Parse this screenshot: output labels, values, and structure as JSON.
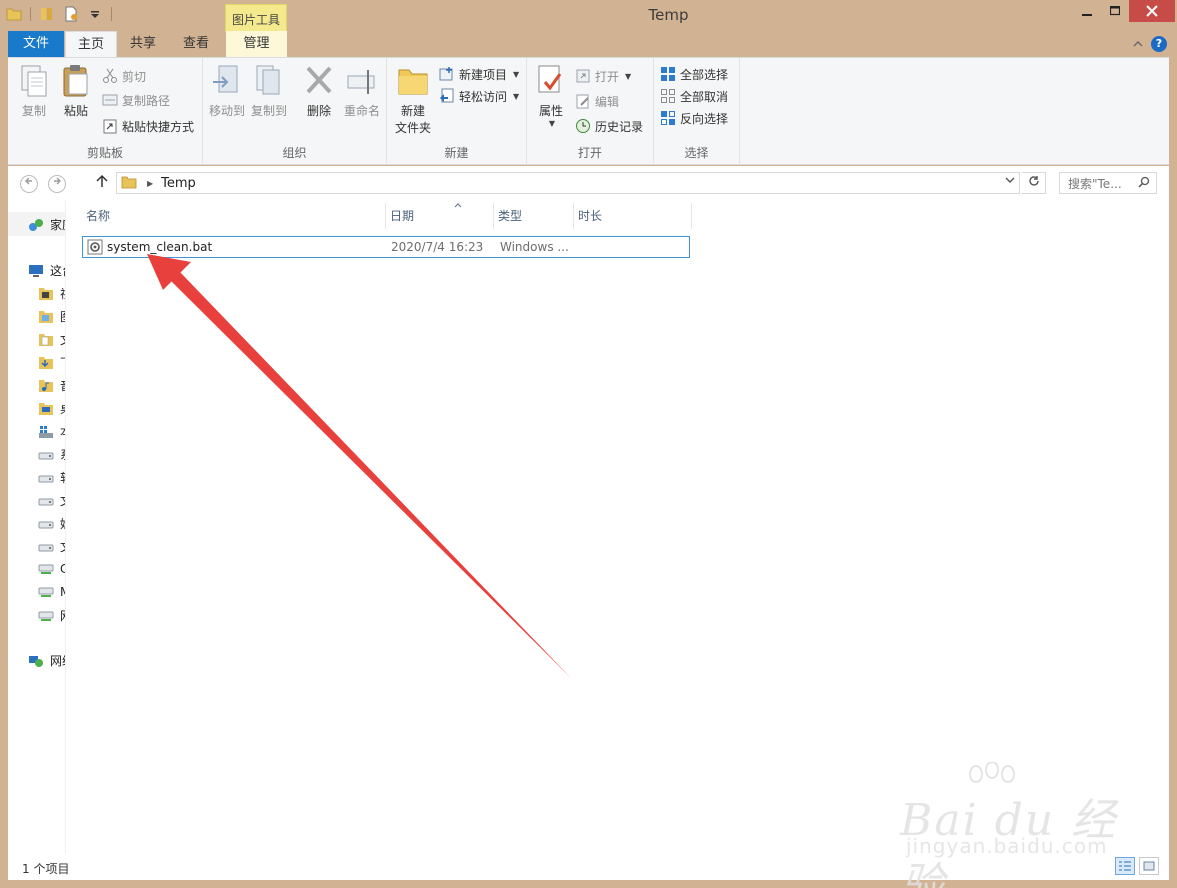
{
  "window": {
    "title": "Temp",
    "context_tab_header": "图片工具"
  },
  "tabs": {
    "file": "文件",
    "home": "主页",
    "share": "共享",
    "view": "查看",
    "manage": "管理"
  },
  "ribbon": {
    "clipboard": {
      "label": "剪贴板",
      "copy": "复制",
      "paste": "粘贴",
      "cut": "剪切",
      "copy_path": "复制路径",
      "paste_shortcut": "粘贴快捷方式"
    },
    "organize": {
      "label": "组织",
      "move_to": "移动到",
      "copy_to": "复制到",
      "delete": "删除",
      "rename": "重命名"
    },
    "new": {
      "label": "新建",
      "new_folder_line1": "新建",
      "new_folder_line2": "文件夹",
      "new_item": "新建项目",
      "easy_access": "轻松访问"
    },
    "open": {
      "label": "打开",
      "properties": "属性",
      "open": "打开",
      "edit": "编辑",
      "history": "历史记录"
    },
    "select": {
      "label": "选择",
      "select_all": "全部选择",
      "select_none": "全部取消",
      "invert": "反向选择"
    }
  },
  "address": {
    "crumb": "Temp",
    "search_placeholder": "搜索\"Te..."
  },
  "navpane": {
    "items": [
      "家庭",
      "这台",
      "视",
      "图",
      "文",
      "下",
      "音",
      "桌",
      "本",
      "系",
      "软",
      "文",
      "娱",
      "文",
      "C",
      "M",
      "网",
      "网络"
    ]
  },
  "columns": {
    "name": "名称",
    "date": "日期",
    "type": "类型",
    "length": "时长"
  },
  "files": [
    {
      "name": "system_clean.bat",
      "date": "2020/7/4 16:23",
      "type": "Windows ..."
    }
  ],
  "status": {
    "count": "1 个项目"
  },
  "watermark": {
    "brand": "Bai du 经验",
    "url": "jingyan.baidu.com"
  },
  "colors": {
    "accent": "#1979ca",
    "frame": "#d1b393",
    "selection_border": "#3f93d7",
    "arrow": "#e8403c"
  }
}
